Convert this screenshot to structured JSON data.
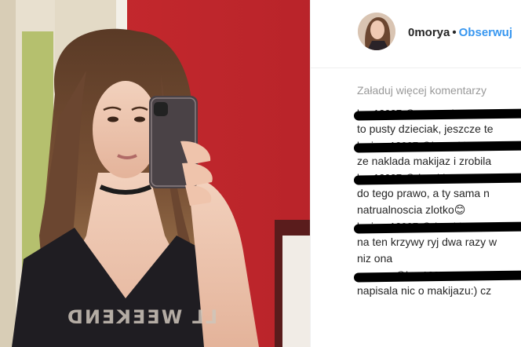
{
  "post": {
    "username": "0morya",
    "separator": "•",
    "follow_label": "Obserwuj"
  },
  "photo": {
    "shirt_text": "LL WEEKEND"
  },
  "comments": {
    "load_more": "Załaduj więcej komentarzy",
    "items": [
      {
        "user": "kr...12037 @y...s.zach",
        "text": "to pusty dzieciak, jeszcze te"
      },
      {
        "user": "krainez12037 @ly...m.bl",
        "text": "ze naklada makijaz i zrobila"
      },
      {
        "user": "kr...12037 @d...s.bl",
        "text": "do tego prawo, a ty sama n\nnatrualnoscia zlotko😊"
      },
      {
        "user": "krainez12037 @d...s.bl",
        "text": "na ten krzywy ryj dwa razy w\nniz ona"
      },
      {
        "user": "m...y...a @kr...12037",
        "text": "napisala nic o makijazu:) cz"
      }
    ]
  }
}
